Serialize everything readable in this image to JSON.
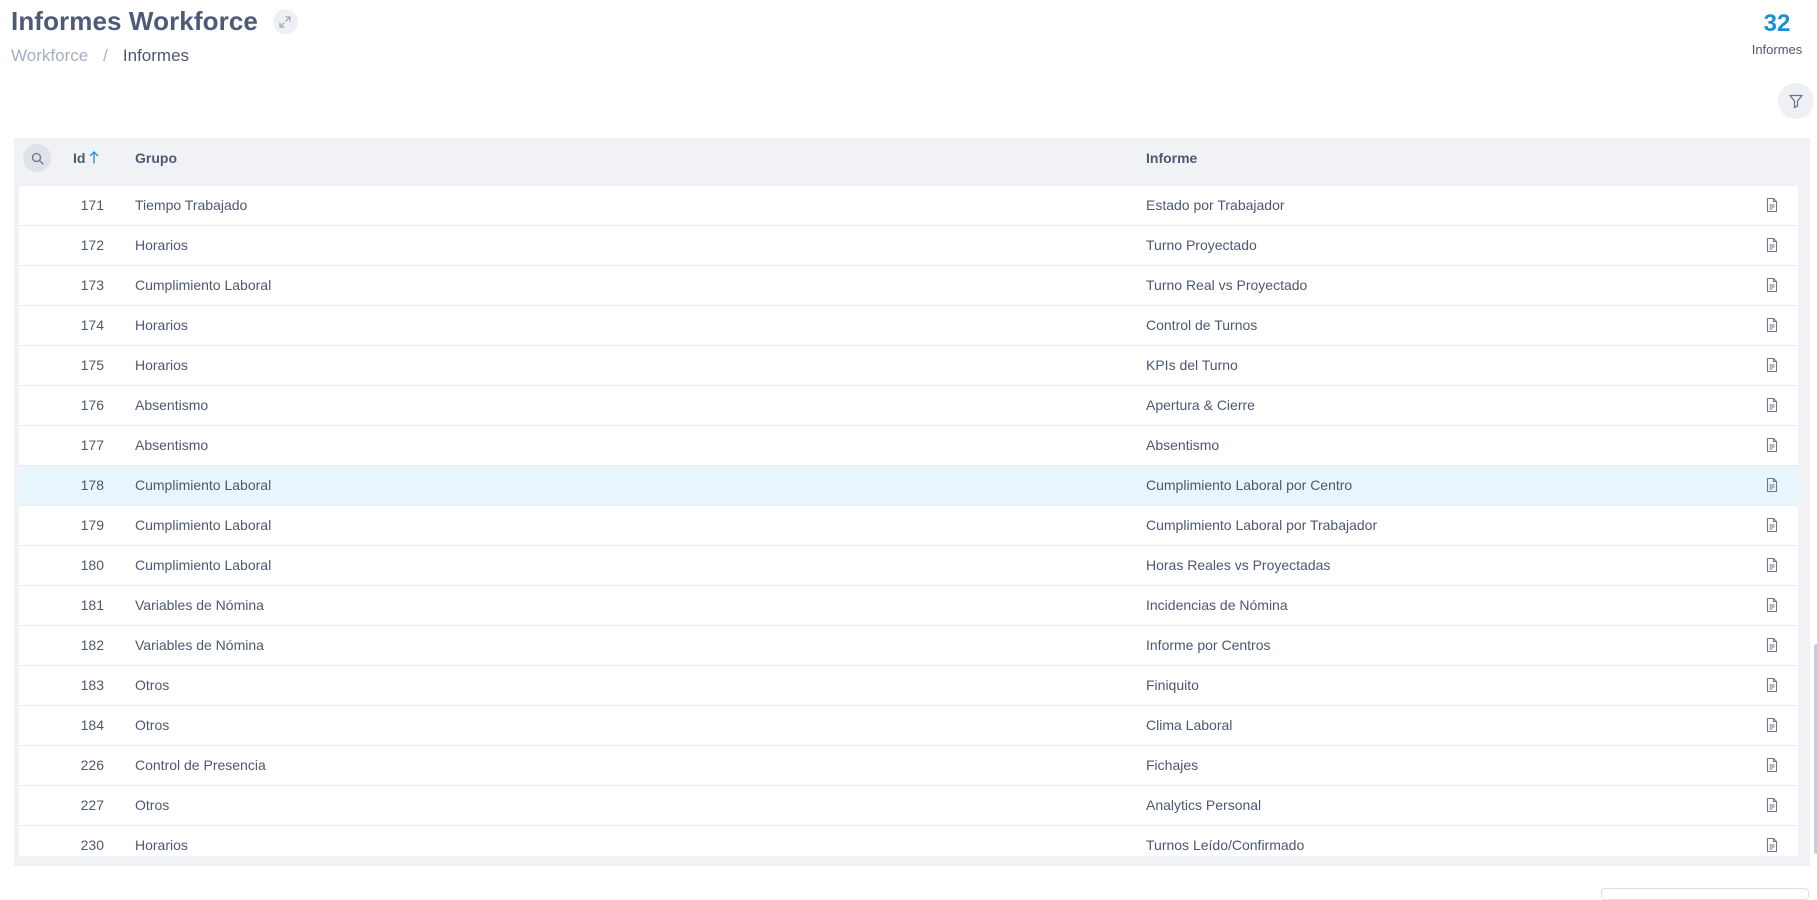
{
  "header": {
    "title": "Informes Workforce",
    "expand_icon": "expand-icon",
    "breadcrumb": {
      "root": "Workforce",
      "separator": "/",
      "current": "Informes"
    },
    "count": {
      "value": "32",
      "label": "Informes"
    },
    "filter_icon": "filter-icon"
  },
  "colors": {
    "accent": "#1a8fd8",
    "title": "#4d5a78",
    "row_highlight": "#e9f5fc",
    "header_bg": "#f1f2f5"
  },
  "table": {
    "search_icon": "search-icon",
    "sort_icon": "arrow-up-icon",
    "columns": {
      "id": "Id",
      "grupo": "Grupo",
      "informe": "Informe"
    },
    "row_action_icon": "report-icon",
    "highlighted_row_id": "178",
    "rows": [
      {
        "id": "171",
        "grupo": "Tiempo Trabajado",
        "informe": "Estado por Trabajador"
      },
      {
        "id": "172",
        "grupo": "Horarios",
        "informe": "Turno Proyectado"
      },
      {
        "id": "173",
        "grupo": "Cumplimiento Laboral",
        "informe": "Turno Real vs Proyectado"
      },
      {
        "id": "174",
        "grupo": "Horarios",
        "informe": "Control de Turnos"
      },
      {
        "id": "175",
        "grupo": "Horarios",
        "informe": "KPIs del Turno"
      },
      {
        "id": "176",
        "grupo": "Absentismo",
        "informe": "Apertura & Cierre"
      },
      {
        "id": "177",
        "grupo": "Absentismo",
        "informe": "Absentismo"
      },
      {
        "id": "178",
        "grupo": "Cumplimiento Laboral",
        "informe": "Cumplimiento Laboral por Centro"
      },
      {
        "id": "179",
        "grupo": "Cumplimiento Laboral",
        "informe": "Cumplimiento Laboral por Trabajador"
      },
      {
        "id": "180",
        "grupo": "Cumplimiento Laboral",
        "informe": "Horas Reales vs Proyectadas"
      },
      {
        "id": "181",
        "grupo": "Variables de Nómina",
        "informe": "Incidencias de Nómina"
      },
      {
        "id": "182",
        "grupo": "Variables de Nómina",
        "informe": "Informe por Centros"
      },
      {
        "id": "183",
        "grupo": "Otros",
        "informe": "Finiquito"
      },
      {
        "id": "184",
        "grupo": "Otros",
        "informe": "Clima Laboral"
      },
      {
        "id": "226",
        "grupo": "Control de Presencia",
        "informe": "Fichajes"
      },
      {
        "id": "227",
        "grupo": "Otros",
        "informe": "Analytics Personal"
      },
      {
        "id": "230",
        "grupo": "Horarios",
        "informe": "Turnos Leído/Confirmado"
      }
    ]
  }
}
